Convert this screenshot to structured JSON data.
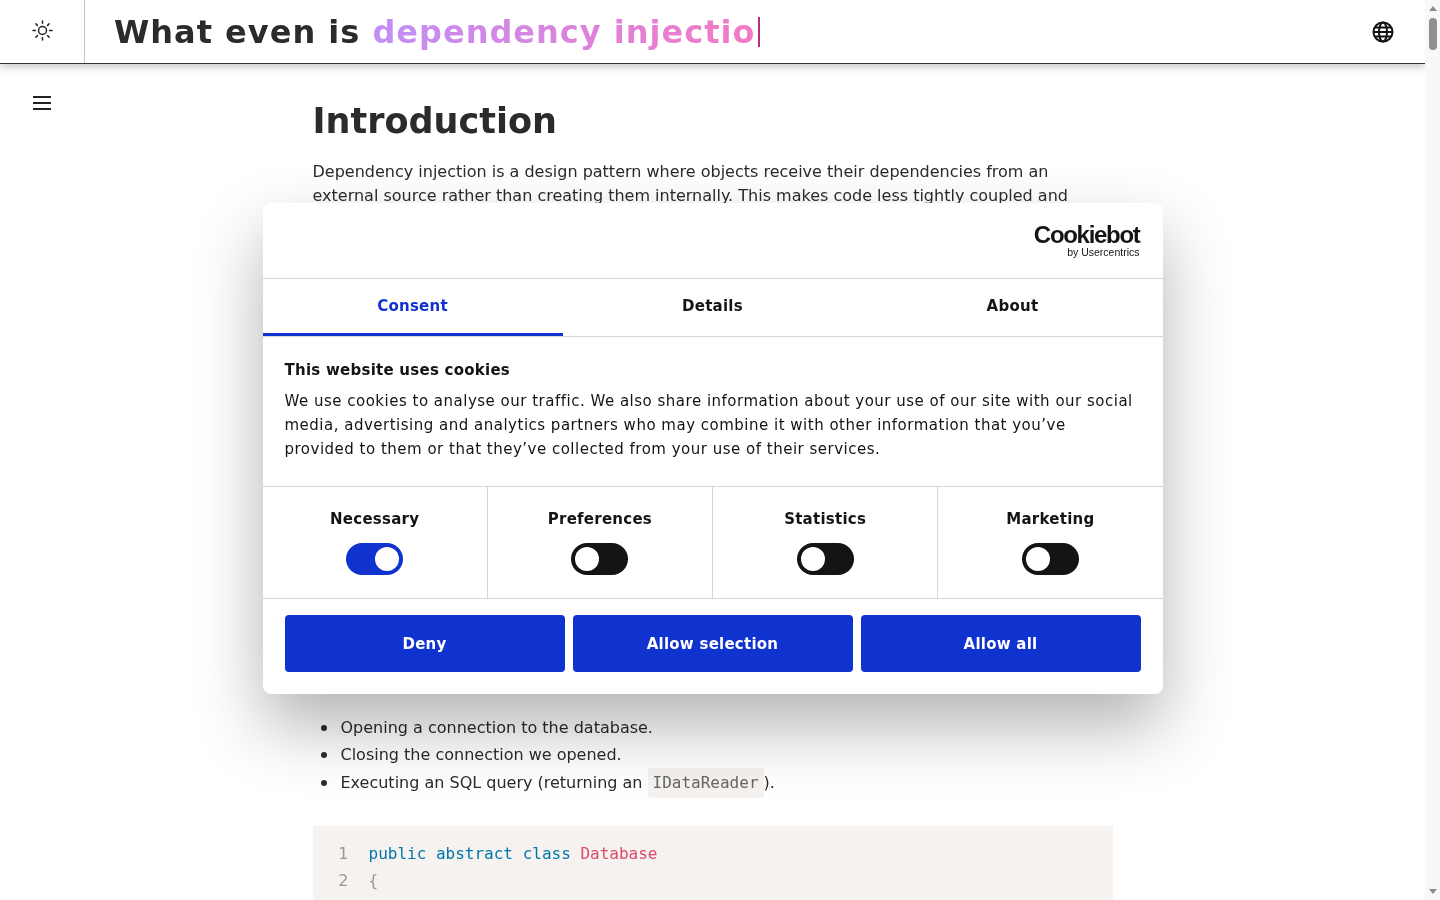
{
  "header": {
    "title": "What even is",
    "typed_text": "dependency injectio"
  },
  "article": {
    "heading": "Introduction",
    "intro": "Dependency injection is a design pattern where objects receive their dependencies from an external source rather than creating them internally. This makes code less tightly coupled and",
    "list": [
      {
        "parts": [
          {
            "kind": "text",
            "text": "Opening a connection to the database."
          }
        ]
      },
      {
        "parts": [
          {
            "kind": "text",
            "text": "Closing the connection we opened."
          }
        ]
      },
      {
        "parts": [
          {
            "kind": "text",
            "text": "Executing an SQL query (returning an "
          },
          {
            "kind": "code",
            "text": "IDataReader"
          },
          {
            "kind": "text",
            "text": ")."
          }
        ]
      }
    ],
    "code_block": {
      "lines": [
        {
          "number": "1",
          "tokens": [
            {
              "kind": "keyword",
              "text": "public abstract class"
            },
            {
              "kind": "class-name",
              "text": "Database"
            }
          ]
        },
        {
          "number": "2",
          "tokens": [
            {
              "kind": "punctuation",
              "text": "{"
            }
          ]
        }
      ]
    }
  },
  "cookie_dialog": {
    "logo": {
      "wordmark": "Cookiebot",
      "tagline": "by Usercentrics"
    },
    "tabs": [
      {
        "label": "Consent",
        "selected": true
      },
      {
        "label": "Details",
        "selected": false
      },
      {
        "label": "About",
        "selected": false
      }
    ],
    "title": "This website uses cookies",
    "body": "We use cookies to analyse our traffic. We also share information about your use of our site with our social media, advertising and analytics partners who may combine it with other information that you’ve provided to them or that they’ve collected from your use of their services.",
    "categories": [
      {
        "label": "Necessary",
        "on": true
      },
      {
        "label": "Preferences",
        "on": false
      },
      {
        "label": "Statistics",
        "on": false
      },
      {
        "label": "Marketing",
        "on": false
      }
    ],
    "buttons": [
      "Deny",
      "Allow selection",
      "Allow all"
    ]
  }
}
